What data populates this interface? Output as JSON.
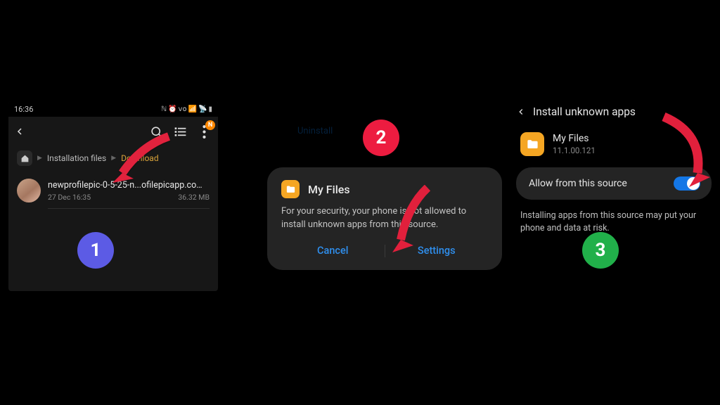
{
  "panel1": {
    "statusbar": {
      "time": "16:36",
      "carrier_icon": "card-icon"
    },
    "breadcrumb": {
      "level1": "Installation files",
      "level2": "Download"
    },
    "file": {
      "name": "newprofilepic-0-5-25-n...ofilepicapp.com_.apk",
      "date": "27 Dec 16:35",
      "size": "36.32 MB"
    },
    "more_badge": "N"
  },
  "panel2": {
    "dim_uninstall": "Uninstall",
    "dialog": {
      "app_name": "My Files",
      "body": "For your security, your phone is not allowed to install unknown apps from this source.",
      "cancel": "Cancel",
      "settings": "Settings"
    }
  },
  "panel3": {
    "title": "Install unknown apps",
    "app": {
      "name": "My Files",
      "version": "11.1.00.121"
    },
    "allow_label": "Allow from this source",
    "warning": "Installing apps from this source may put your phone and data at risk."
  },
  "badges": {
    "one": "1",
    "two": "2",
    "three": "3"
  }
}
